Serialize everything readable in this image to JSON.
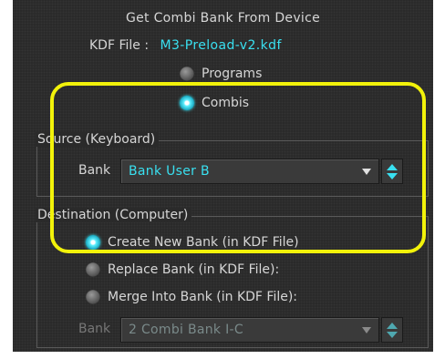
{
  "dialog": {
    "title": "Get Combi Bank From Device",
    "kdf_label": "KDF File :",
    "kdf_value": "M3-Preload-v2.kdf"
  },
  "bank_type": {
    "options": [
      "Programs",
      "Combis"
    ],
    "selected": "Combis"
  },
  "source": {
    "group_label": "Source (Keyboard)",
    "bank_label": "Bank",
    "bank_value": "Bank User B"
  },
  "destination": {
    "group_label": "Destination (Computer)",
    "options": [
      "Create New Bank (in KDF File)",
      "Replace Bank (in KDF File):",
      "Merge Into Bank (in KDF File):"
    ],
    "selected": "Create New Bank (in KDF File)",
    "bank_label": "Bank",
    "bank_value": "2 Combi Bank I-C"
  },
  "colors": {
    "accent": "#39e0f0",
    "highlight": "#f2f20a",
    "background": "#2a2a2a"
  }
}
